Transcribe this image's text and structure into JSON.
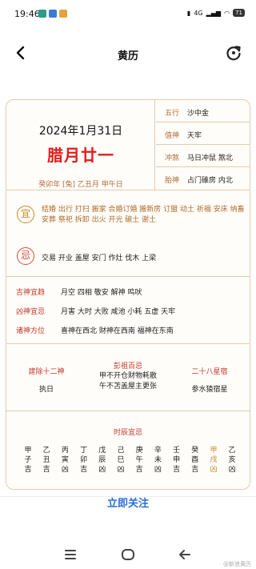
{
  "status_bar": {
    "time": "19:46",
    "network": "4G",
    "battery": "71"
  },
  "header": {
    "title": "黄历"
  },
  "almanac": {
    "solar_date": "2024年1月31日",
    "lunar_date": "腊月廿一",
    "ganzhi": "癸卯年 [兔] 乙丑月 甲午日",
    "info": [
      {
        "label": "五行",
        "value": "沙中金"
      },
      {
        "label": "值神",
        "value": "天牢"
      },
      {
        "label": "冲煞",
        "value": "马日冲鼠 煞北"
      },
      {
        "label": "胎神",
        "value": "占门碓房 内北"
      }
    ],
    "yi_label": "宜",
    "yi_items": "结婚 出行 打扫 搬家 合婚订婚 搬新房 订盟 动土 祈福 安床 纳畜 安葬 祭祀 拆卸 出火 开光 破土 谢土",
    "ji_label": "忌",
    "ji_items": "交易 开业 盖屋 安门 作灶 伐木 上梁",
    "gods": [
      {
        "label": "吉神宜趋",
        "value": "月空 四相 敬安 解神 鸣吠"
      },
      {
        "label": "凶神宜忌",
        "value": "月害 大时 大败 咸池 小耗 五虚 天牢"
      },
      {
        "label": "诸神方位",
        "value": "喜神在西北 财神在西南 福神在东南"
      }
    ],
    "jianchu": {
      "title": "建除十二神",
      "value": "执日"
    },
    "pengzu": {
      "title": "彭祖百忌",
      "line1": "甲不开仓财物耗散",
      "line2": "午不苫盖屋主更张"
    },
    "xiu": {
      "title": "二十八星宿",
      "value": "参水猿宿星"
    },
    "hours_title": "时辰宜忌",
    "hours": [
      {
        "stem": "甲",
        "branch": "子",
        "luck": "吉"
      },
      {
        "stem": "乙",
        "branch": "丑",
        "luck": "吉"
      },
      {
        "stem": "丙",
        "branch": "寅",
        "luck": "凶"
      },
      {
        "stem": "丁",
        "branch": "卯",
        "luck": "吉"
      },
      {
        "stem": "戊",
        "branch": "辰",
        "luck": "凶"
      },
      {
        "stem": "己",
        "branch": "巳",
        "luck": "凶"
      },
      {
        "stem": "庚",
        "branch": "午",
        "luck": "吉"
      },
      {
        "stem": "辛",
        "branch": "未",
        "luck": "凶"
      },
      {
        "stem": "壬",
        "branch": "申",
        "luck": "吉"
      },
      {
        "stem": "癸",
        "branch": "酉",
        "luck": "吉"
      },
      {
        "stem": "甲",
        "branch": "戌",
        "luck": "凶"
      },
      {
        "stem": "乙",
        "branch": "亥",
        "luck": "凶"
      }
    ],
    "highlighted_hour_index": 10
  },
  "follow_button": "立即关注",
  "watermark": "@新浪黄历",
  "colors": {
    "accent_red": "#e21b1b",
    "label_brown": "#b16c3b",
    "border": "#e8c9b2",
    "link_blue": "#2a6fd8"
  }
}
